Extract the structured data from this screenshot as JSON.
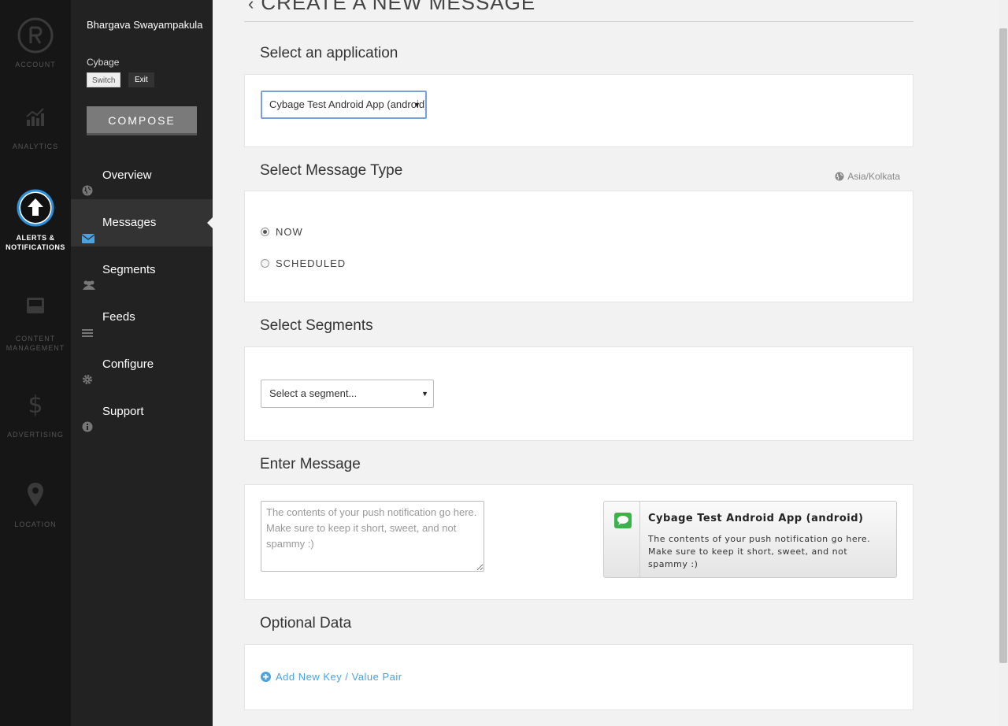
{
  "rail": {
    "items": [
      {
        "label": "ACCOUNT",
        "icon": "account-logo-icon"
      },
      {
        "label": "ANALYTICS",
        "icon": "analytics-chart-icon"
      },
      {
        "label_line1": "ALERTS &",
        "label_line2": "NOTIFICATIONS",
        "icon": "upload-arrow-icon"
      },
      {
        "label_line1": "CONTENT",
        "label_line2": "MANAGEMENT",
        "icon": "inbox-tray-icon"
      },
      {
        "label": "ADVERTISING",
        "icon": "dollar-icon"
      },
      {
        "label": "LOCATION",
        "icon": "map-pin-icon"
      }
    ]
  },
  "sidebar": {
    "user_name": "Bhargava Swayampakula",
    "org_name": "Cybage",
    "switch_label": "Switch",
    "exit_label": "Exit",
    "compose_label": "COMPOSE",
    "items": [
      {
        "label": "Overview",
        "icon": "globe-icon"
      },
      {
        "label": "Messages",
        "icon": "envelope-icon"
      },
      {
        "label": "Segments",
        "icon": "users-icon"
      },
      {
        "label": "Feeds",
        "icon": "list-icon"
      },
      {
        "label": "Configure",
        "icon": "gear-icon"
      },
      {
        "label": "Support",
        "icon": "info-icon"
      }
    ]
  },
  "main": {
    "title": "CREATE A NEW MESSAGE",
    "app_section": {
      "heading": "Select an application",
      "selected": "Cybage Test Android App (android)"
    },
    "type_section": {
      "heading": "Select Message Type",
      "timezone": "Asia/Kolkata",
      "options": [
        {
          "label": "NOW",
          "checked": true
        },
        {
          "label": "SCHEDULED",
          "checked": false
        }
      ]
    },
    "segments_section": {
      "heading": "Select Segments",
      "selected": "Select a segment..."
    },
    "message_section": {
      "heading": "Enter Message",
      "placeholder": "The contents of your push notification go here. Make sure to keep it short, sweet, and not spammy :)",
      "preview_title": "Cybage Test Android App (android)",
      "preview_body": "The contents of your push notification go here. Make sure to keep it short, sweet, and not spammy :)"
    },
    "optional_section": {
      "heading": "Optional Data",
      "add_label": "Add New Key / Value Pair"
    }
  },
  "colors": {
    "accent": "#4aa3df",
    "rail_bg": "#161616",
    "sidebar_bg": "#222222",
    "page_bg": "#f2f2f2"
  }
}
